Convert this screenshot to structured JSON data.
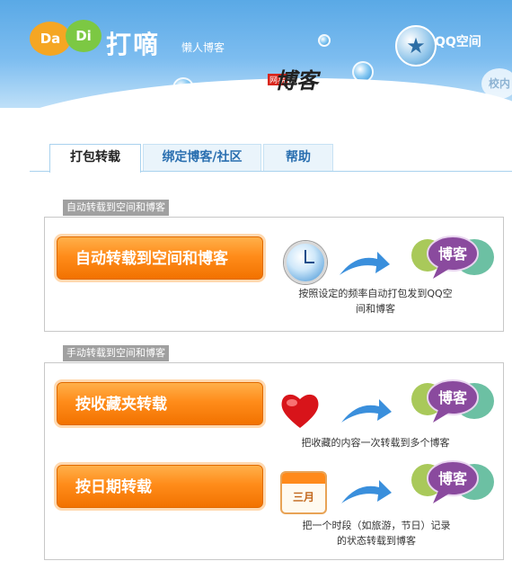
{
  "header": {
    "logo_left": "Da",
    "logo_right": "Di",
    "title": "打嘀",
    "subtitle": "懒人博客",
    "seal_main": "博客",
    "seal_sub": "网易",
    "qq_label": "QQ空间",
    "xiaonei_label": "校内"
  },
  "tabs": [
    {
      "label": "打包转载",
      "active": true
    },
    {
      "label": "绑定博客/社区",
      "active": false
    },
    {
      "label": "帮助",
      "active": false
    }
  ],
  "section_auto": {
    "label": "自动转载到空间和博客",
    "button": "自动转载到空间和博客",
    "icon": "clock-icon",
    "desc_line1": "按照设定的频率自动打包发到QQ空",
    "desc_line2": "间和博客",
    "target_label": "博客"
  },
  "section_manual": {
    "label": "手动转载到空间和博客",
    "row1": {
      "button": "按收藏夹转载",
      "icon": "heart-icon",
      "desc_line1": "把收藏的内容一次转载到多个博客",
      "target_label": "博客"
    },
    "row2": {
      "button": "按日期转载",
      "icon": "calendar-icon",
      "calendar_text": "三月",
      "desc_line1": "把一个时段（如旅游，节日）记录",
      "desc_line2": "的状态转载到博客",
      "target_label": "博客"
    }
  },
  "colors": {
    "header_blue": "#5aa9e6",
    "button_orange": "#ff8c1a",
    "tab_text": "#2a6fb0",
    "bubble_purple": "#8a4a9e",
    "bubble_green": "#8fbf4a"
  }
}
